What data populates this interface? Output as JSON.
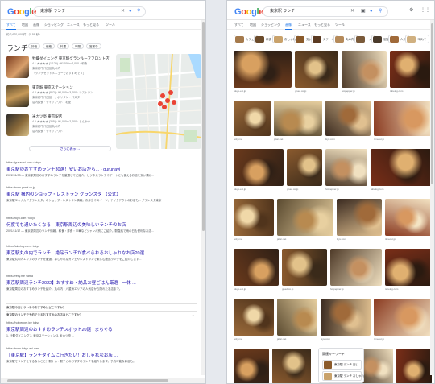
{
  "left": {
    "search_query": "東京駅 ランチ",
    "tabs": [
      "すべて",
      "地図",
      "画像",
      "ショッピング",
      "ニュース",
      "もっと見る",
      "ツール"
    ],
    "result_stats": "約 2,670,000 件 （0.58 秒）",
    "local_heading": "ランチ",
    "filters": [
      "評価",
      "価格",
      "料理",
      "時間",
      "営業中"
    ],
    "places": [
      {
        "name": "牡蠣ダイニング 東京駅グランルーフフロント店",
        "line1": "4.1 ★★★★ (1,120) · ¥1,000～2,000 · 和食",
        "line2": "東京都千代田区丸の内",
        "line3": "「ランチセットメニューでおすすめです」"
      },
      {
        "name": "東京駅 東京ステーション",
        "line1": "4.2 ★★★★ (862) · ¥2,000～3,000 · レストラン",
        "line2": "東京都千代田区 · ナポリタン・パスタ",
        "line3": "店内飲食 · テイクアウト · 宅配"
      },
      {
        "name": "米カツ亭 東京駅店",
        "line1": "4.0 ★★★★ (305) · ¥1,000～2,000 · とんかつ",
        "line2": "東京都千代田区丸の内",
        "line3": "店内飲食 · テイクアウト"
      }
    ],
    "more_places": "さらに表示 →",
    "results": [
      {
        "url": "https://gurunavi.com › tokyo",
        "title": "東京駅のおすすめランチ30選！安いお店から... - gurunavi",
        "snippet": "2022/01/03 — 東京駅周辺のおすすめランチを厳選してご紹介。ビジネスランチやデートにも使えるお店を安い順に..."
      },
      {
        "url": "https://www.gnavi.co.jp",
        "title": "東京駅 構内のショップ・レストラン グランスタ 【公式】",
        "snippet": "東京駅エキナカ「グランスタ」のショップ・レストラン情報。お弁当やスイーツ、テイクアウトのお店も... グランスタ東京"
      },
      {
        "url": "https://ikyu.com › tokyo",
        "title": "何度でも通いたくなる！東京駅周辺の美味しいランチのお店",
        "snippet": "2021/11/17 — 東京駅周辺のランチ情報。和食・洋食・中華などジャンル別にご紹介。駅直結で雨の日も便利なお店..."
      },
      {
        "url": "https://tabelog.com › tokyo",
        "title": "東京駅丸の内でランチ！絶品ランチが食べられるおしゃれなお店20選",
        "snippet": "東京駅丸の内エリアのランチを厳選。おしゃれなカフェやレストランで楽しむ絶品ランチをご紹介します..."
      },
      {
        "url": "https://retty.me › area",
        "title": "東京駅周辺ランチ2022】おすすめ・絶品お昼ごはん厳選 - 一休 ...",
        "snippet": "東京駅周辺のおすすめランチを紹介。丸の内・八重洲エリアの人気店から隠れた名店まで。"
      },
      {
        "url": "https://hotpepper.jp › tokyo",
        "title": "東京駅周辺のおすすめランチスポット20選 | まちぐる",
        "snippet": "1. 牡蠣ダイニング 2. 東京ステーション 3. 米カツ亭 ..."
      },
      {
        "url": "https://www.tokyo-eki.com",
        "title": "【東京駅】ランチタイムに行きたい！おしゃれなお店 ...",
        "snippet": "東京駅でランチをするならここ！駅ナカ・駅チカのおすすめランチを紹介します。予約可能なお店も。"
      }
    ],
    "paa": [
      "東京駅の安いランチのおすすめはどこですか？",
      "東京駅のランチで予約できるおすすめのお店はどこですか？"
    ]
  },
  "right": {
    "search_query": "東京駅 ランチ",
    "tabs": [
      "すべて",
      "地図",
      "ショッピング",
      "画像",
      "ニュース",
      "もっと見る",
      "ツール"
    ],
    "chips": [
      "カフェ",
      "和食",
      "おしゃれ",
      "安い",
      "ステーキ",
      "丸の内",
      "一人",
      "個室",
      "人気",
      "コスパ"
    ],
    "captions": [
      "tokyo-eki.jp",
      "gnavi.co.jp",
      "hotpepper.jp",
      "tabelog.com",
      "retty.me",
      "jalan.net",
      "ikyu.com",
      "timeout.jp"
    ],
    "panel_title": "関連キーワード",
    "panel_items": [
      "東京駅 ランチ 安い",
      "東京駅 ランチ おしゃれ"
    ]
  },
  "colors": {
    "link": "#1a0dab",
    "accent": "#1a73e8",
    "star": "#f5a623",
    "pin": "#ea4335"
  }
}
